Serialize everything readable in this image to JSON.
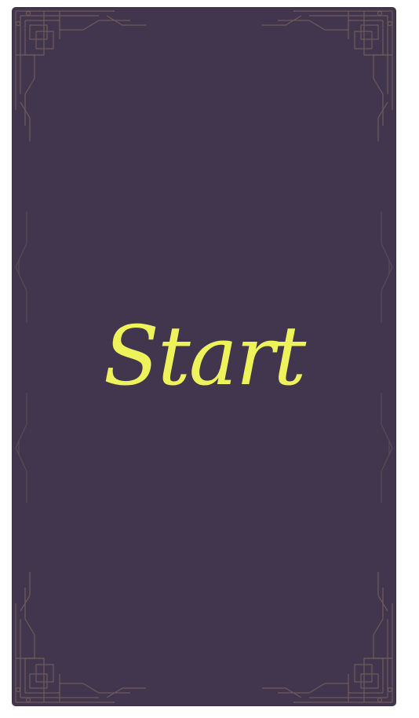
{
  "card": {
    "label": "Start"
  },
  "colors": {
    "card_background": "#41364d",
    "label_text": "#eef35c",
    "ornament_line": "#6f5a5a",
    "page_background": "#ffffff"
  },
  "icons": {
    "corner_ornament": "art-deco-corner-ornament",
    "edge_ornament": "triangle-bracket-ornament"
  }
}
